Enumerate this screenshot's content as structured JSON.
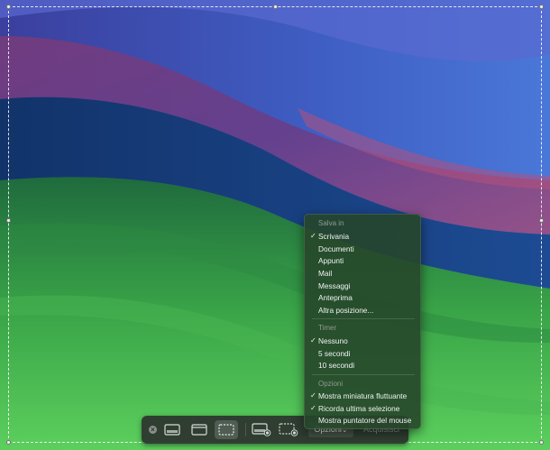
{
  "toolbar": {
    "close_icon": "×",
    "options_label": "Opzioni",
    "options_chevron": "⌄",
    "capture_label": "Acquisisci",
    "buttons": [
      {
        "name": "capture-entire-screen-icon",
        "active": false
      },
      {
        "name": "capture-window-icon",
        "active": false
      },
      {
        "name": "capture-selection-icon",
        "active": true
      },
      {
        "name": "record-entire-screen-icon",
        "active": false
      },
      {
        "name": "record-selection-icon",
        "active": false
      }
    ]
  },
  "menu": {
    "save_header": "Salva in",
    "save_items": [
      {
        "label": "Scrivania",
        "checked": true
      },
      {
        "label": "Documenti",
        "checked": false
      },
      {
        "label": "Appunti",
        "checked": false
      },
      {
        "label": "Mail",
        "checked": false
      },
      {
        "label": "Messaggi",
        "checked": false
      },
      {
        "label": "Anteprima",
        "checked": false
      },
      {
        "label": "Altra posizione...",
        "checked": false
      }
    ],
    "timer_header": "Timer",
    "timer_items": [
      {
        "label": "Nessuno",
        "checked": true
      },
      {
        "label": "5 secondi",
        "checked": false
      },
      {
        "label": "10 secondi",
        "checked": false
      }
    ],
    "options_header": "Opzioni",
    "options_items": [
      {
        "label": "Mostra miniatura fluttuante",
        "checked": true
      },
      {
        "label": "Ricorda ultima selezione",
        "checked": true
      },
      {
        "label": "Mostra puntatore del mouse",
        "checked": false
      }
    ],
    "check_glyph": "✓"
  },
  "colors": {
    "menu_bg": "#26462a",
    "toolbar_bg": "#2b322e",
    "header_text": "#8f9b92"
  }
}
